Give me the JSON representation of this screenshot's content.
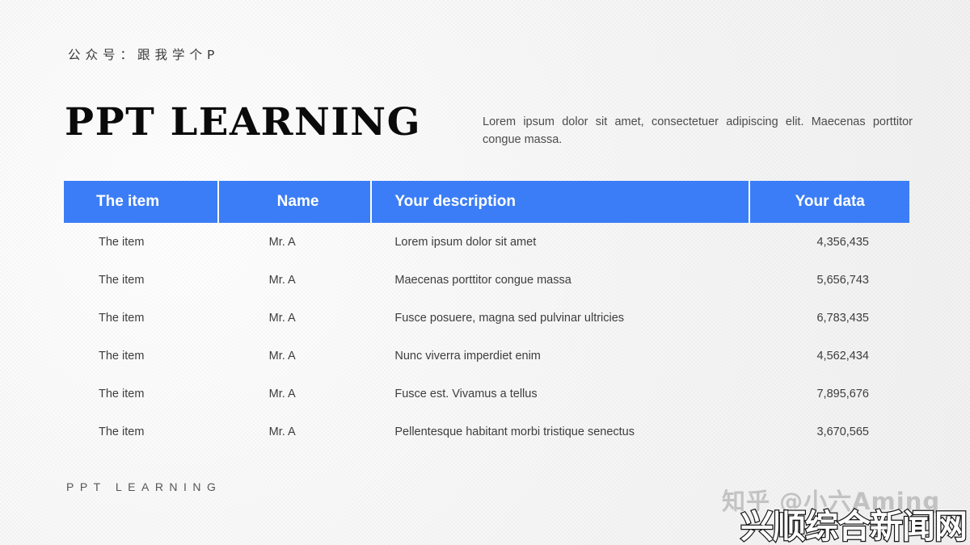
{
  "header": {
    "wechat_handle": "公众号：跟我学个P",
    "title": "PPT LEARNING",
    "intro": "Lorem ipsum dolor sit amet, consectetuer adipiscing elit. Maecenas porttitor congue massa."
  },
  "table": {
    "accent_color": "#3b7df6",
    "header_text_color": "#ffffff",
    "body_text_color": "#3d3d3d",
    "columns": [
      {
        "key": "item",
        "label": "The item"
      },
      {
        "key": "name",
        "label": "Name"
      },
      {
        "key": "description",
        "label": "Your description"
      },
      {
        "key": "data",
        "label": "Your data"
      }
    ],
    "rows": [
      {
        "item": "The item",
        "name": "Mr. A",
        "description": "Lorem ipsum dolor sit amet",
        "data": "4,356,435"
      },
      {
        "item": "The item",
        "name": "Mr. A",
        "description": "Maecenas porttitor congue massa",
        "data": "5,656,743"
      },
      {
        "item": "The item",
        "name": "Mr. A",
        "description": "Fusce posuere, magna sed pulvinar ultricies",
        "data": "6,783,435"
      },
      {
        "item": "The item",
        "name": "Mr. A",
        "description": "Nunc viverra imperdiet enim",
        "data": "4,562,434"
      },
      {
        "item": "The item",
        "name": "Mr. A",
        "description": "Fusce est. Vivamus a tellus",
        "data": "7,895,676"
      },
      {
        "item": "The item",
        "name": "Mr. A",
        "description": "Pellentesque habitant morbi tristique senectus",
        "data": "3,670,565"
      }
    ]
  },
  "footer": {
    "brand": "PPT LEARNING"
  },
  "watermarks": {
    "zhihu": "知乎 @小六Aming",
    "site": "兴顺综合新闻网"
  }
}
